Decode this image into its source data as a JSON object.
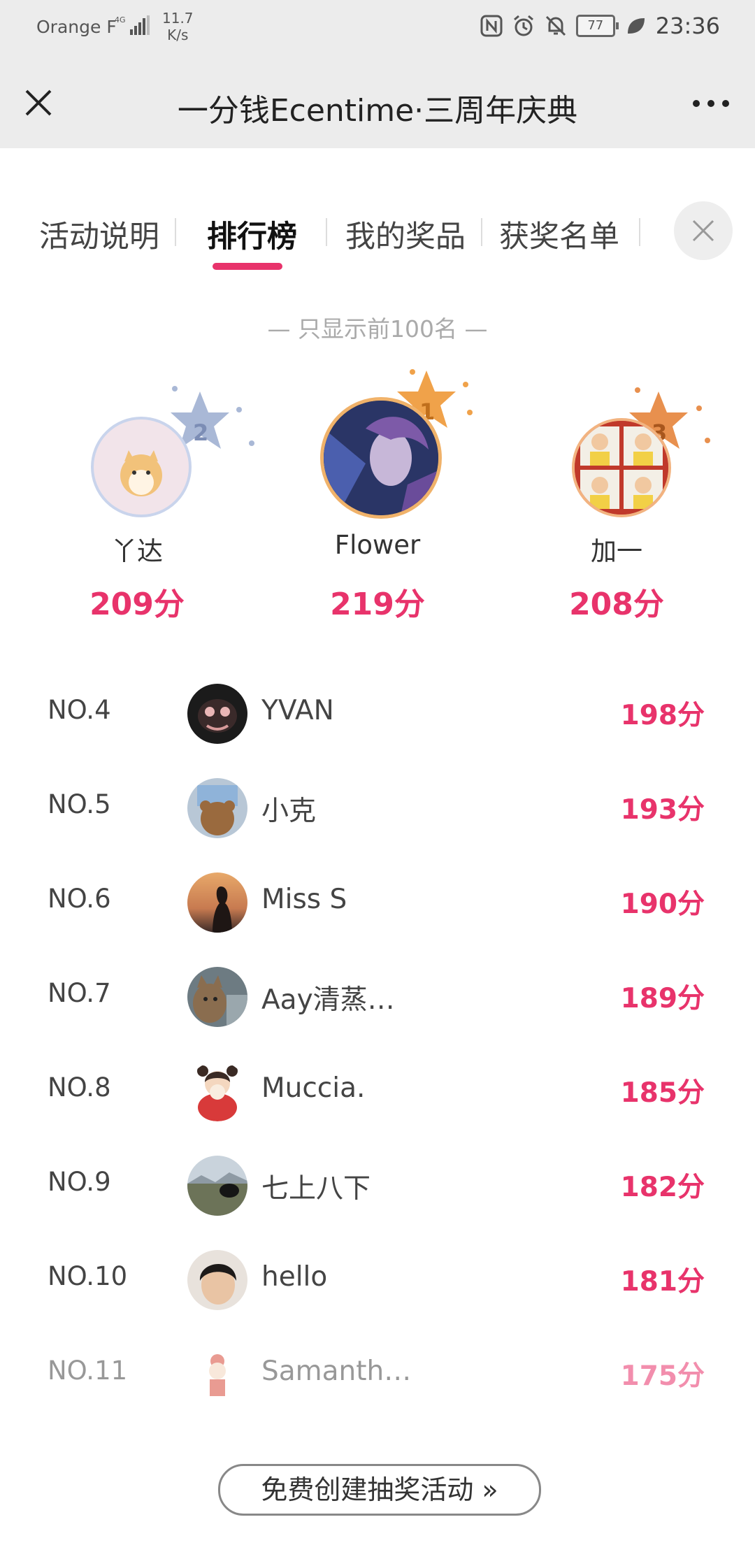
{
  "status_bar": {
    "carrier": "Orange F",
    "network": "4G",
    "speed_value": "11.7",
    "speed_unit": "K/s",
    "battery": "77",
    "time": "23:36"
  },
  "title_bar": {
    "title": "一分钱Ecentime·三周年庆典"
  },
  "tabs": [
    {
      "label": "活动说明",
      "active": false
    },
    {
      "label": "排行榜",
      "active": true
    },
    {
      "label": "我的奖品",
      "active": false
    },
    {
      "label": "获奖名单",
      "active": false
    }
  ],
  "notice": "— 只显示前100名 —",
  "podium": [
    {
      "rank": "2",
      "name": "丫达",
      "score": "209分"
    },
    {
      "rank": "1",
      "name": "Flower",
      "score": "219分"
    },
    {
      "rank": "3",
      "name": "加一",
      "score": "208分"
    }
  ],
  "ranking": [
    {
      "rank": "NO.4",
      "name": "YVAN",
      "score": "198分"
    },
    {
      "rank": "NO.5",
      "name": "小克",
      "score": "193分"
    },
    {
      "rank": "NO.6",
      "name": "Miss S",
      "score": "190分"
    },
    {
      "rank": "NO.7",
      "name": "Aay清蒸…",
      "score": "189分"
    },
    {
      "rank": "NO.8",
      "name": "Muccia.",
      "score": "185分"
    },
    {
      "rank": "NO.9",
      "name": "七上八下",
      "score": "182分"
    },
    {
      "rank": "NO.10",
      "name": "hello",
      "score": "181分"
    },
    {
      "rank": "NO.11",
      "name": "Samanth…",
      "score": "175分"
    }
  ],
  "create_button": "免费创建抽奖活动 »",
  "colors": {
    "accent": "#e8336b",
    "bar_bg": "#ececec",
    "gold": "#f0a24a",
    "silver": "#a9b8d6",
    "bronze": "#e8904e"
  }
}
